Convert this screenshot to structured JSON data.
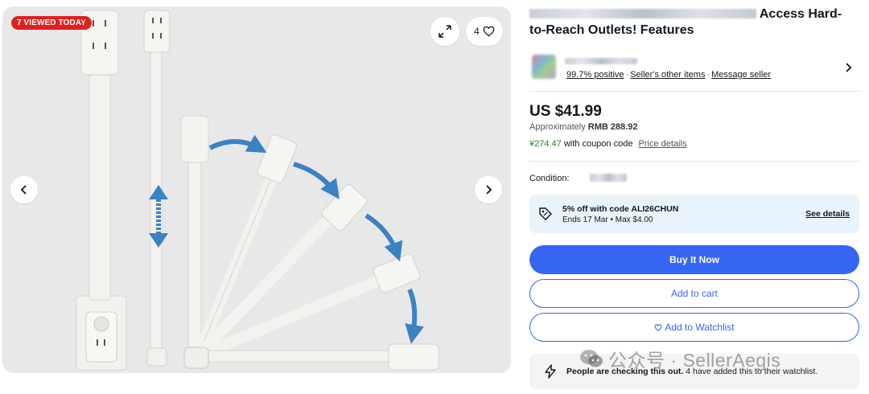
{
  "gallery": {
    "badge": "7 VIEWED TODAY",
    "watch_count": "4",
    "icons": {
      "expand": "expand-icon",
      "heart": "heart-icon",
      "prev": "chevron-left-icon",
      "next": "chevron-right-icon"
    }
  },
  "listing": {
    "title_visible": "Access Hard-to-Reach Outlets! Features"
  },
  "seller": {
    "feedback": "99.7% positive",
    "other_items": "Seller's other items",
    "message": "Message seller"
  },
  "pricing": {
    "price": "US $41.99",
    "approx_label": "Approximately",
    "approx_value": "RMB 288.92",
    "coupon_price": "¥274.47",
    "coupon_text": "with coupon code",
    "price_details": "Price details"
  },
  "condition": {
    "label": "Condition:"
  },
  "promo": {
    "title": "5% off with code ALI26CHUN",
    "subtitle": "Ends 17 Mar • Max $4.00",
    "link": "See details"
  },
  "actions": {
    "buy_now": "Buy It Now",
    "add_to_cart": "Add to cart",
    "add_to_watchlist": "Add to Watchlist"
  },
  "social_proof": {
    "bold": "People are checking this out.",
    "rest": "4 have added this to their watchlist."
  },
  "watermark": "公众号 · SellerAegis",
  "colors": {
    "accent": "#3665f3",
    "badge": "#e0201f",
    "coupon_green": "#26862f",
    "promo_bg": "#e9f3fb"
  }
}
